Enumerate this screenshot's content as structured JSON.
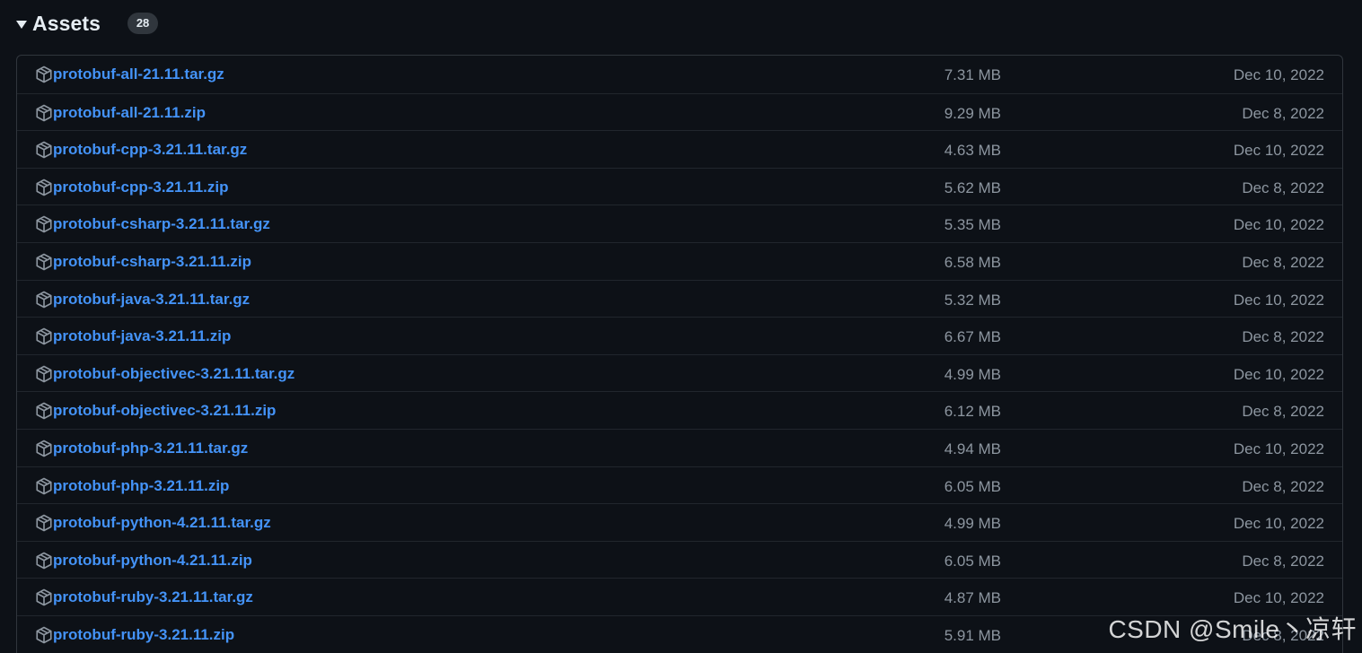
{
  "assets": {
    "title": "Assets",
    "count": "28",
    "items": [
      {
        "name": "protobuf-all-21.11.tar.gz",
        "size": "7.31 MB",
        "date": "Dec 10, 2022"
      },
      {
        "name": "protobuf-all-21.11.zip",
        "size": "9.29 MB",
        "date": "Dec 8, 2022"
      },
      {
        "name": "protobuf-cpp-3.21.11.tar.gz",
        "size": "4.63 MB",
        "date": "Dec 10, 2022"
      },
      {
        "name": "protobuf-cpp-3.21.11.zip",
        "size": "5.62 MB",
        "date": "Dec 8, 2022"
      },
      {
        "name": "protobuf-csharp-3.21.11.tar.gz",
        "size": "5.35 MB",
        "date": "Dec 10, 2022"
      },
      {
        "name": "protobuf-csharp-3.21.11.zip",
        "size": "6.58 MB",
        "date": "Dec 8, 2022"
      },
      {
        "name": "protobuf-java-3.21.11.tar.gz",
        "size": "5.32 MB",
        "date": "Dec 10, 2022"
      },
      {
        "name": "protobuf-java-3.21.11.zip",
        "size": "6.67 MB",
        "date": "Dec 8, 2022"
      },
      {
        "name": "protobuf-objectivec-3.21.11.tar.gz",
        "size": "4.99 MB",
        "date": "Dec 10, 2022"
      },
      {
        "name": "protobuf-objectivec-3.21.11.zip",
        "size": "6.12 MB",
        "date": "Dec 8, 2022"
      },
      {
        "name": "protobuf-php-3.21.11.tar.gz",
        "size": "4.94 MB",
        "date": "Dec 10, 2022"
      },
      {
        "name": "protobuf-php-3.21.11.zip",
        "size": "6.05 MB",
        "date": "Dec 8, 2022"
      },
      {
        "name": "protobuf-python-4.21.11.tar.gz",
        "size": "4.99 MB",
        "date": "Dec 10, 2022"
      },
      {
        "name": "protobuf-python-4.21.11.zip",
        "size": "6.05 MB",
        "date": "Dec 8, 2022"
      },
      {
        "name": "protobuf-ruby-3.21.11.tar.gz",
        "size": "4.87 MB",
        "date": "Dec 10, 2022"
      },
      {
        "name": "protobuf-ruby-3.21.11.zip",
        "size": "5.91 MB",
        "date": "Dec 8, 2022"
      }
    ]
  },
  "watermark": "CSDN @Smile丶凉轩",
  "colors": {
    "background": "#0d1117",
    "link": "#4493f8",
    "muted_text": "#8d96a0",
    "border": "#30363d"
  },
  "icons": {
    "toggle": "triangle-down-icon",
    "asset": "package-icon"
  }
}
